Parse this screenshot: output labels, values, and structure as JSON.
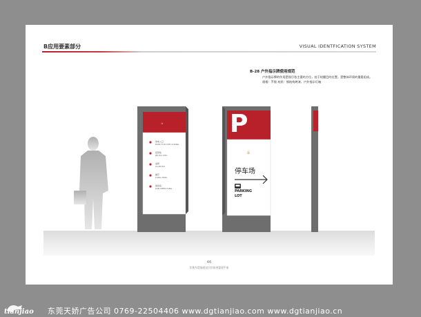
{
  "header": {
    "section_label": "B应用要素部分",
    "system_label": "VISUAL IDENTFICATION SYSTEM"
  },
  "content": {
    "title": "B-28 户外指示牌使用规范",
    "description_line1": "户外指示牌的作用是指引各主要的方位，处于较醒目的位置，是整体环境的重要组成。",
    "description_line2": "规格：不限   材质：钢结构烤漆，户外指示灯箱"
  },
  "sign_directory": {
    "items": [
      {
        "cn": "停车入口",
        "en": "PARK TUO CHE CHANG"
      },
      {
        "cn": "接待处",
        "en": "JIE DAI CHU"
      },
      {
        "cn": "会所",
        "en": "CLUB HUI"
      },
      {
        "cn": "餐厅",
        "en": "CANG TING"
      },
      {
        "cn": "健身房",
        "en": "JIAN SHEN FANG"
      }
    ]
  },
  "sign_parking": {
    "letter": "P",
    "cn_label": "停车场",
    "en_label_1": "PARKING",
    "en_label_2": "LOT"
  },
  "page": {
    "number": "46",
    "footer": "华景东堤城视觉识别系统管理手册"
  },
  "bottom_bar": {
    "logo_text": "tianjiao",
    "company_line": "东莞天娇广告公司   0769-22504406   www.dgtianjiao.com   www.dgtianjiao.cn"
  },
  "colors": {
    "brand_red": "#b8202a",
    "panel_gray": "#6e6e6e",
    "background_gray": "#8e8e8e"
  }
}
